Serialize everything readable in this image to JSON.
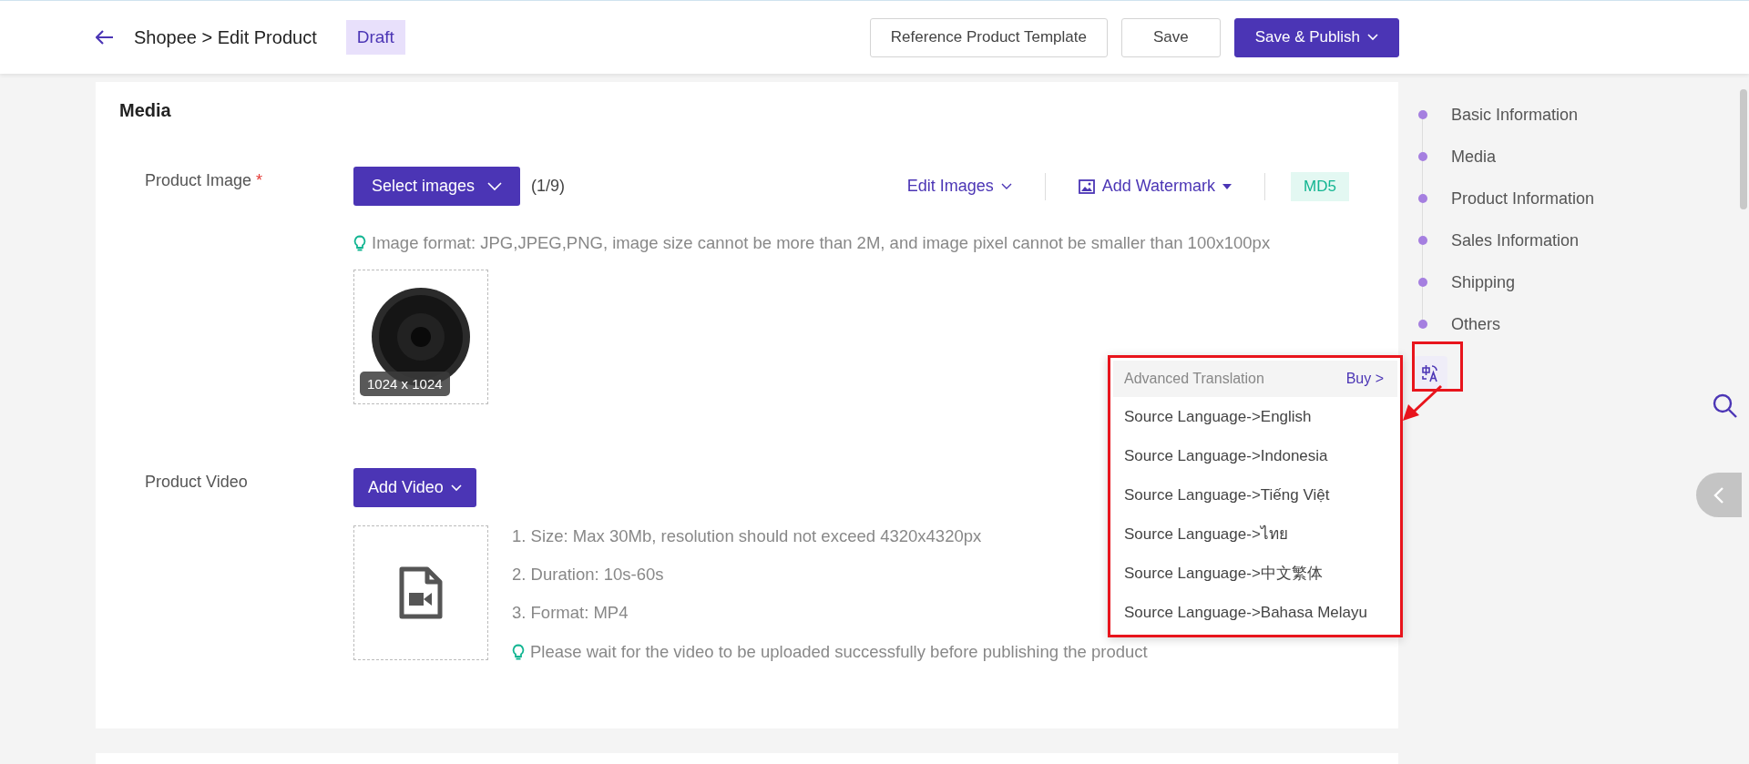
{
  "header": {
    "breadcrumb": "Shopee > Edit Product",
    "status": "Draft",
    "buttons": [
      {
        "label": "Reference Product Template",
        "kind": "outline",
        "caret": false
      },
      {
        "label": "Save",
        "kind": "outline",
        "caret": false
      },
      {
        "label": "Save & Publish",
        "kind": "primary",
        "caret": true
      }
    ]
  },
  "media": {
    "title": "Media",
    "product_image": {
      "label": "Product Image",
      "required_mark": "*",
      "select_button": "Select images",
      "count": "(1/9)",
      "edit_images": "Edit Images",
      "add_watermark": "Add Watermark",
      "md5": "MD5",
      "hint": "Image format: JPG,JPEG,PNG, image size cannot be more than 2M, and image pixel cannot be smaller than 100x100px",
      "thumbnail_size": "1024 x 1024"
    },
    "product_video": {
      "label": "Product Video",
      "add_button": "Add Video",
      "specs": [
        "1. Size: Max 30Mb, resolution should not exceed 4320x4320px",
        "2. Duration: 10s-60s",
        "3. Format: MP4"
      ],
      "hint": "Please wait for the video to be uploaded successfully before publishing the product"
    }
  },
  "section_nav": {
    "items": [
      {
        "label": "Basic Information"
      },
      {
        "label": "Media"
      },
      {
        "label": "Product Information"
      },
      {
        "label": "Sales Information"
      },
      {
        "label": "Shipping"
      },
      {
        "label": "Others"
      }
    ]
  },
  "translation_menu": {
    "title": "Advanced Translation",
    "buy_link": "Buy >",
    "items": [
      {
        "label": "Source Language->English"
      },
      {
        "label": "Source Language->Indonesia"
      },
      {
        "label": "Source Language->Tiếng Việt"
      },
      {
        "label": "Source Language->ไทย"
      },
      {
        "label": "Source Language->中文繁体"
      },
      {
        "label": "Source Language->Bahasa Melayu"
      }
    ]
  }
}
